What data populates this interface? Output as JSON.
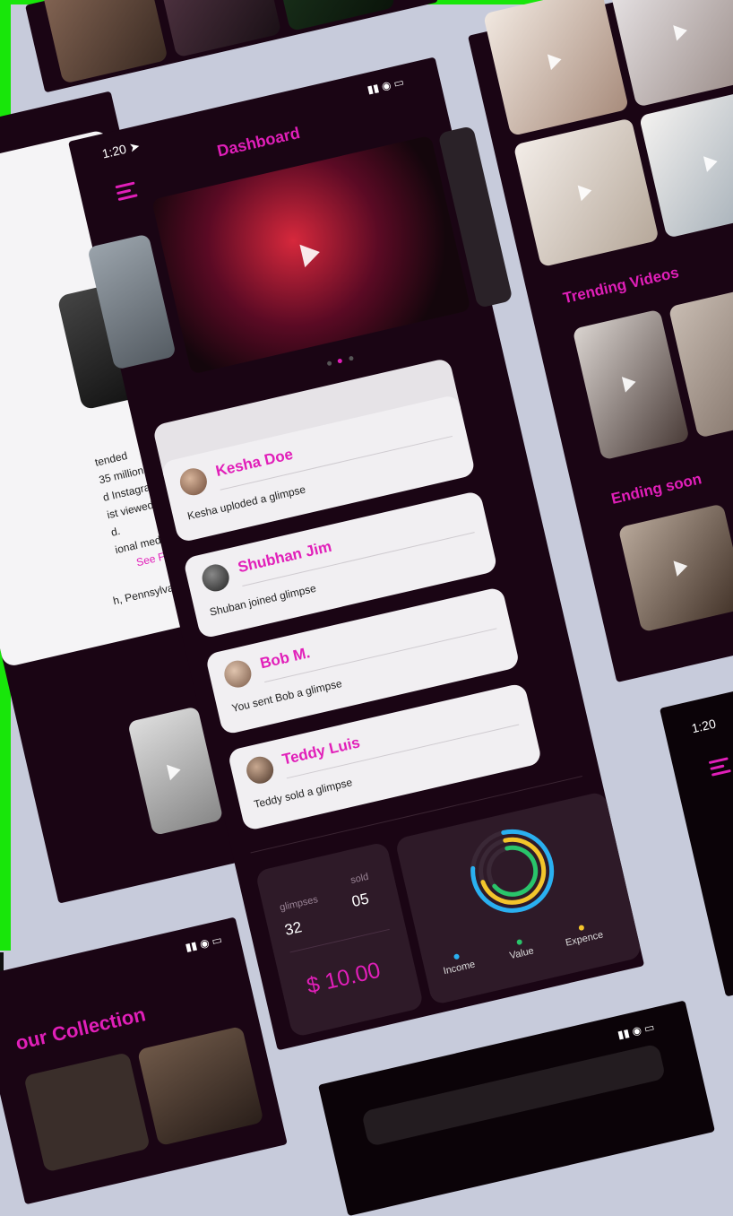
{
  "colors": {
    "accent": "#e11fb9",
    "background": "#c7cbdb",
    "phone": "#1a0514",
    "card": "#f1eff2",
    "income": "#2ab0f0",
    "value": "#29c46a",
    "expence": "#f3c52b"
  },
  "main_phone": {
    "time": "1:20",
    "title": "Dashboard",
    "activity": [
      {
        "name": "Kesha Doe",
        "message": "Kesha uploded a glimpse"
      },
      {
        "name": "Shubhan Jim",
        "message": "Shuban joined glimpse"
      },
      {
        "name": "Bob M.",
        "message": "You sent Bob a glimpse"
      },
      {
        "name": "Teddy Luis",
        "message": "Teddy sold a glimpse"
      }
    ],
    "stats": {
      "glimpses_label": "glimpses",
      "glimpses_value": "32",
      "sold_label": "sold",
      "sold_value": "05",
      "amount": "$ 10.00"
    },
    "legend": {
      "income": "Income",
      "value": "Value",
      "expence": "Expence"
    }
  },
  "right_phone": {
    "trending_title": "Trending Videos",
    "ending_title": "Ending soon"
  },
  "right_bottom_phone": {
    "time": "1:20"
  },
  "left_phone": {
    "bio_lines": [
      "tended",
      "35 million",
      "d Instagram, he",
      "ist viewed",
      "d.",
      "ional media with"
    ],
    "see_full_bio": "See Full Bio ›",
    "location": "h, Pennsylvania, USA"
  },
  "bottom_left_phone": {
    "title": "our Collection"
  }
}
